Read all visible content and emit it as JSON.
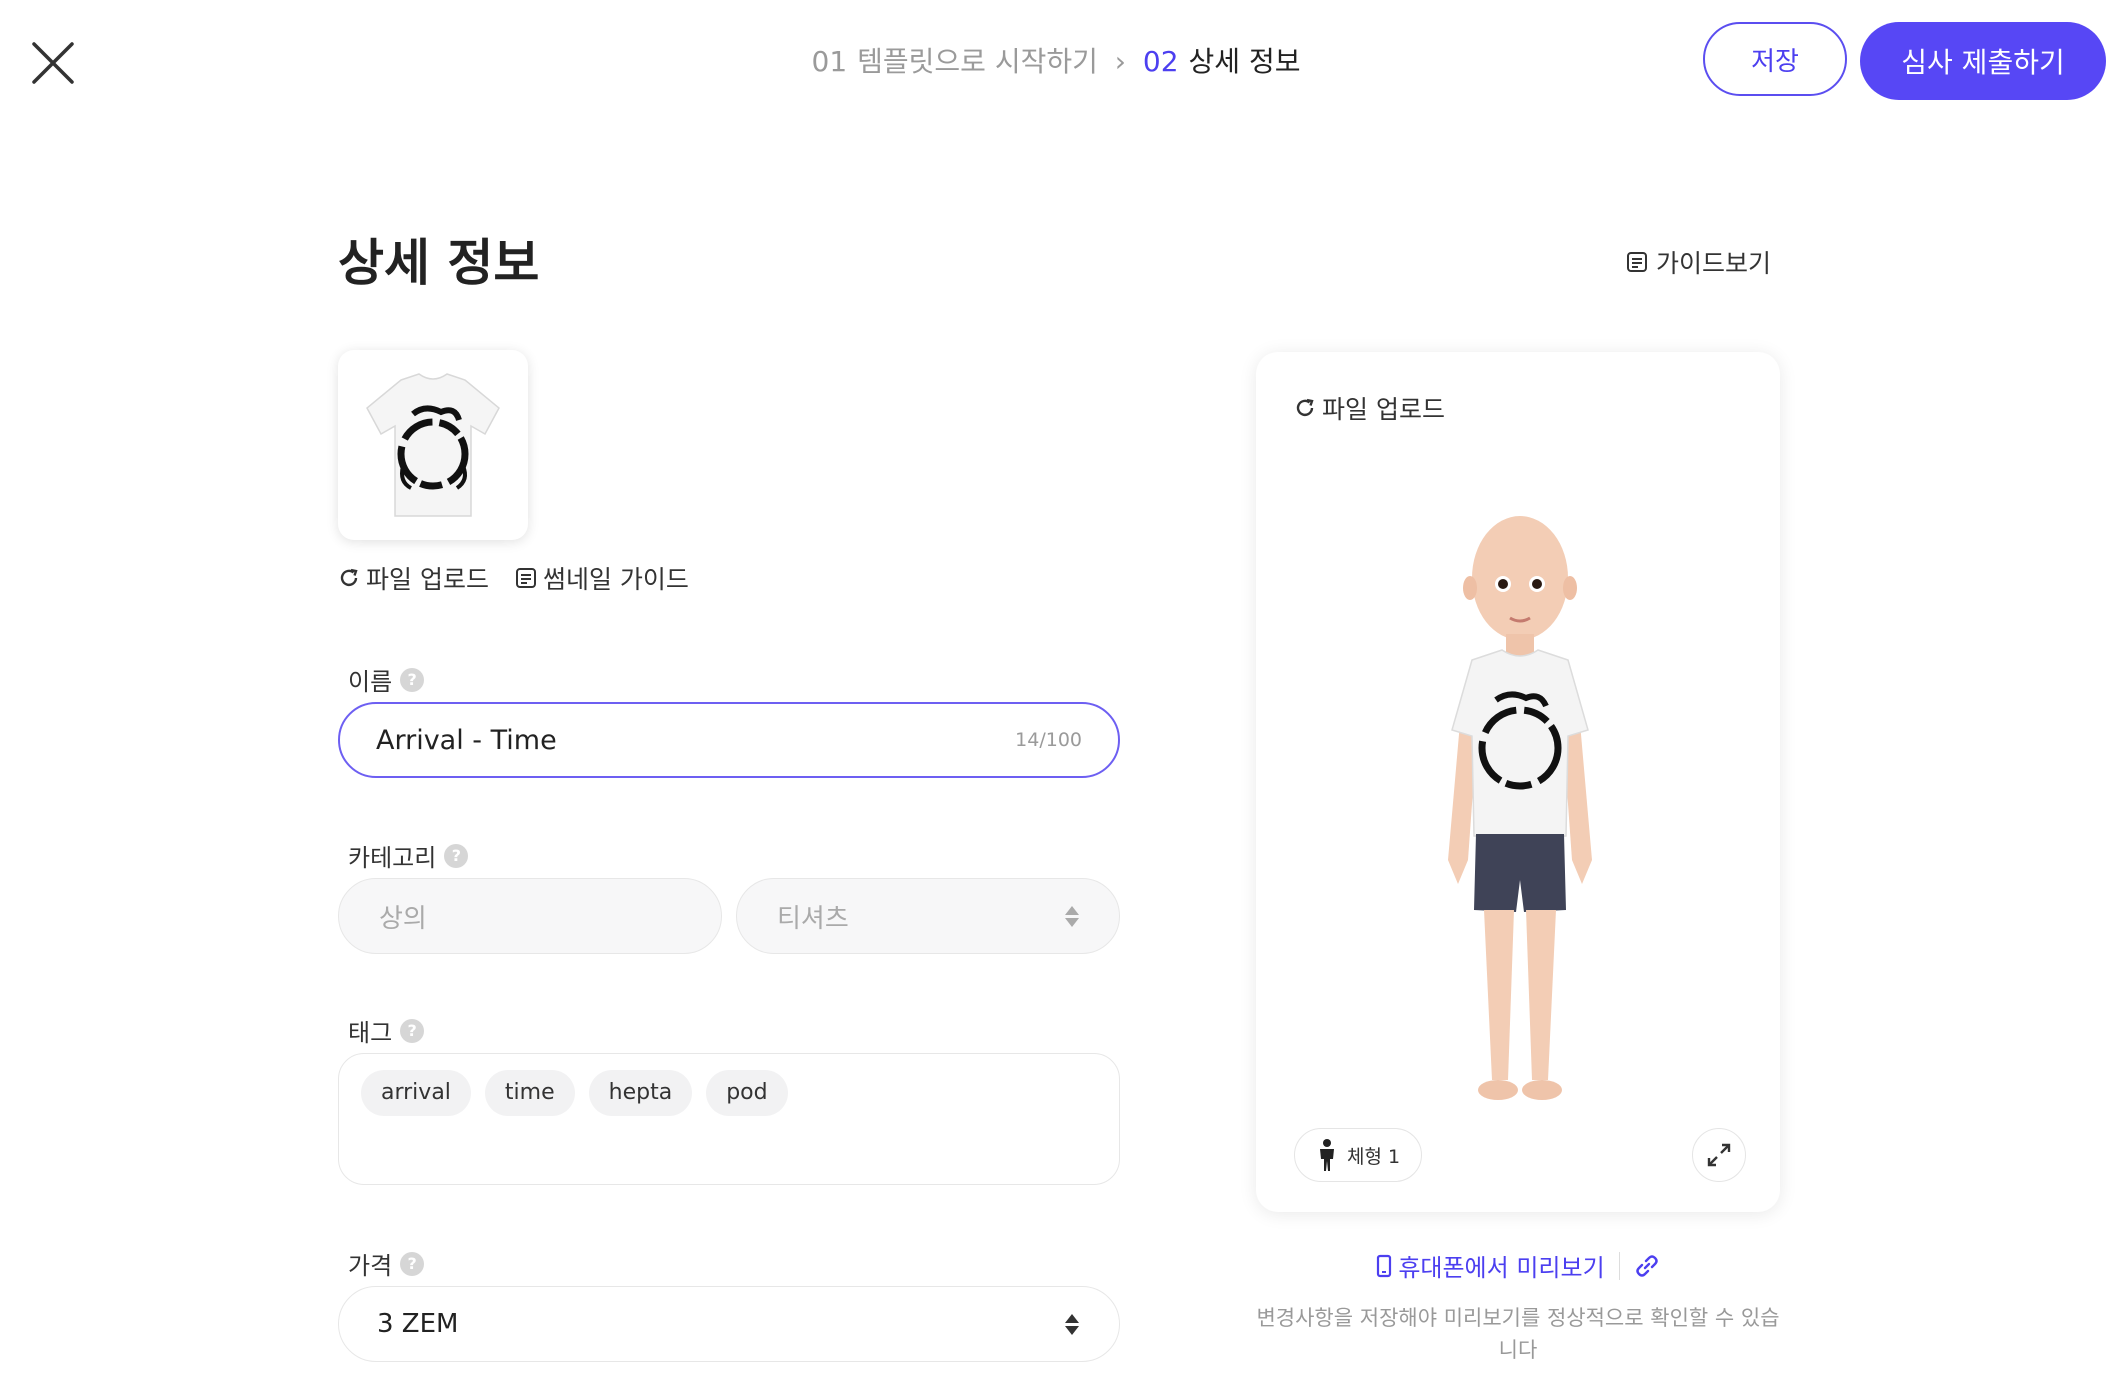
{
  "header": {
    "close_icon": "close-icon",
    "steps": [
      {
        "num": "01",
        "label": "템플릿으로 시작하기"
      },
      {
        "num": "02",
        "label": "상세 정보"
      }
    ],
    "save_label": "저장",
    "submit_label": "심사 제출하기",
    "accent_color": "#5747f5"
  },
  "page": {
    "title": "상세 정보",
    "guide_label": "가이드보기"
  },
  "thumbnail": {
    "upload_label": "파일 업로드",
    "guide_label": "썸네일 가이드"
  },
  "fields": {
    "name": {
      "label": "이름",
      "value": "Arrival - Time",
      "count": "14/100"
    },
    "category": {
      "label": "카테고리",
      "primary": "상의",
      "secondary": "티셔츠"
    },
    "tags": {
      "label": "태그",
      "items": [
        "arrival",
        "time",
        "hepta",
        "pod"
      ]
    },
    "price": {
      "label": "가격",
      "value": "3 ZEM"
    }
  },
  "preview": {
    "upload_label": "파일 업로드",
    "body_type_label": "체형 1",
    "mobile_preview_label": "휴대폰에서 미리보기",
    "note": "변경사항을 저장해야 미리보기를 정상적으로 확인할 수 있습니다"
  }
}
